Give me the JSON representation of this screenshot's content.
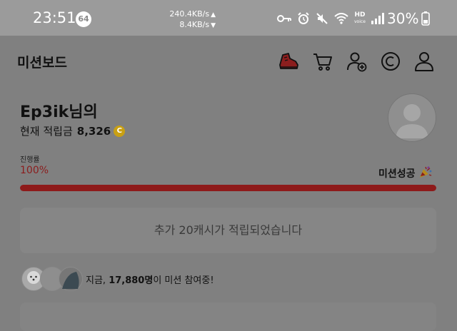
{
  "status_bar": {
    "time": "23:51",
    "notification_count": "64",
    "upload_speed": "240.4KB/s",
    "download_speed": "8.4KB/s",
    "hd_label": "HD",
    "hd_sub_label": "voice",
    "battery": "30%",
    "icons": [
      "vpn-key-icon",
      "alarm-icon",
      "mute-icon",
      "wifi-icon",
      "hd-voice-icon",
      "signal-icon",
      "battery-icon"
    ]
  },
  "header": {
    "title": "미션보드",
    "icons": [
      "mission-shoe-icon",
      "cart-icon",
      "add-user-icon",
      "coin-c-icon",
      "profile-icon"
    ]
  },
  "user": {
    "name_line": "Ep3ik님의",
    "points_label": "현재 적립금",
    "points_value": "8,326",
    "coin_symbol": "C"
  },
  "progress": {
    "label": "진행률",
    "value": "100%",
    "fraction": 1.0,
    "status": "미션성공"
  },
  "message": "추가 20캐시가 적립되었습니다",
  "participants": {
    "prefix": "지금, ",
    "count": "17,880명",
    "suffix": "이 미션 참여중!"
  },
  "colors": {
    "accent_red": "#8e1a1a",
    "coin_gold": "#c9a013",
    "overlay_gray": "#808080"
  }
}
